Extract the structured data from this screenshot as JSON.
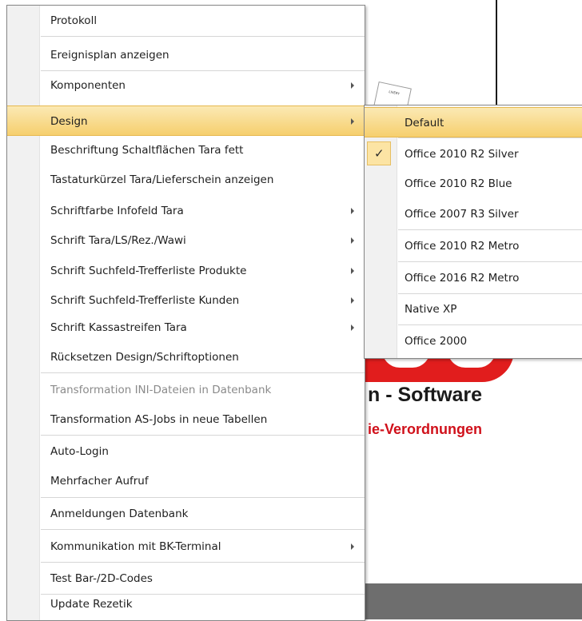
{
  "background": {
    "software_text": "n - Software",
    "verordnungen_text": "ie-Verordnungen",
    "doc_text": "LIVERY"
  },
  "menu": {
    "items": [
      {
        "label": "Protokoll",
        "submenu": false
      },
      {
        "label": "Ereignisplan anzeigen",
        "submenu": false
      },
      {
        "label": "Komponenten",
        "submenu": true
      },
      {
        "label": "Design",
        "submenu": true,
        "highlighted": true
      },
      {
        "label": "Beschriftung Schaltflächen Tara fett",
        "submenu": false
      },
      {
        "label": "Tastaturkürzel Tara/Lieferschein anzeigen",
        "submenu": false
      },
      {
        "label": "Schriftfarbe Infofeld Tara",
        "submenu": true
      },
      {
        "label": "Schrift Tara/LS/Rez./Wawi",
        "submenu": true
      },
      {
        "label": "Schrift Suchfeld-Trefferliste Produkte",
        "submenu": true
      },
      {
        "label": "Schrift Suchfeld-Trefferliste Kunden",
        "submenu": true
      },
      {
        "label": "Schrift Kassastreifen Tara",
        "submenu": true
      },
      {
        "label": "Rücksetzen Design/Schriftoptionen",
        "submenu": false
      },
      {
        "label": "Transformation INI-Dateien in Datenbank",
        "submenu": false,
        "disabled": true
      },
      {
        "label": "Transformation AS-Jobs in neue Tabellen",
        "submenu": false
      },
      {
        "label": "Auto-Login",
        "submenu": false
      },
      {
        "label": "Mehrfacher Aufruf",
        "submenu": false
      },
      {
        "label": "Anmeldungen Datenbank",
        "submenu": false
      },
      {
        "label": "Kommunikation mit BK-Terminal",
        "submenu": true
      },
      {
        "label": "Test Bar-/2D-Codes",
        "submenu": false
      },
      {
        "label": "Update Rezetik",
        "submenu": false
      }
    ]
  },
  "design_submenu": {
    "items": [
      {
        "label": "Default",
        "highlighted": true
      },
      {
        "label": "Office 2010 R2 Silver",
        "checked": true
      },
      {
        "label": "Office 2010 R2 Blue"
      },
      {
        "label": "Office 2007 R3 Silver"
      },
      {
        "label": "Office 2010 R2 Metro"
      },
      {
        "label": "Office 2016 R2 Metro"
      },
      {
        "label": "Native XP"
      },
      {
        "label": "Office 2000"
      }
    ],
    "check_glyph": "✓"
  },
  "colors": {
    "highlight_top": "#fbe9b4",
    "highlight_bottom": "#f6cf6e",
    "logo_red": "#e11d1d",
    "verordnungen_red": "#d0101a"
  }
}
